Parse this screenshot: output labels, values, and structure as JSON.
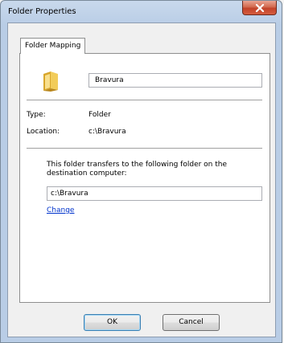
{
  "window": {
    "title": "Folder Properties"
  },
  "tabs": [
    {
      "label": "Folder Mapping"
    }
  ],
  "folder": {
    "name": "Bravura"
  },
  "properties": [
    {
      "label": "Type:",
      "value": "Folder"
    },
    {
      "label": "Location:",
      "value": "c:\\Bravura"
    }
  ],
  "destination": {
    "description": "This folder transfers to the following folder on the destination computer:",
    "path": "c:\\Bravura",
    "change_label": "Change"
  },
  "buttons": {
    "ok": "OK",
    "cancel": "Cancel"
  },
  "icons": {
    "close": "close-icon",
    "folder": "folder-icon"
  },
  "colors": {
    "link": "#0033cc",
    "close_button": "#c24229"
  }
}
